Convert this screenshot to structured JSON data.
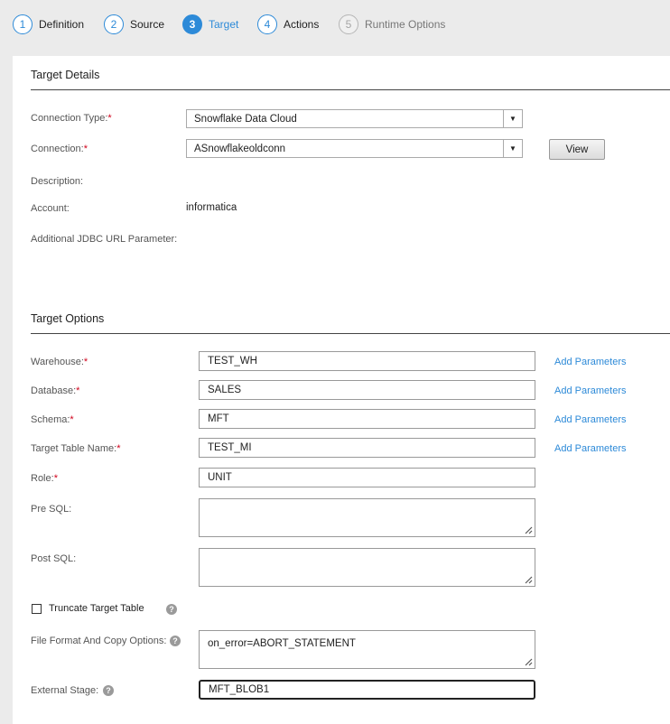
{
  "wizard": {
    "steps": [
      {
        "number": "1",
        "label": "Definition"
      },
      {
        "number": "2",
        "label": "Source"
      },
      {
        "number": "3",
        "label": "Target"
      },
      {
        "number": "4",
        "label": "Actions"
      },
      {
        "number": "5",
        "label": "Runtime Options"
      }
    ],
    "active_step": "Target"
  },
  "target_details": {
    "title": "Target Details",
    "connection_type_label": "Connection Type:",
    "connection_type_value": "Snowflake Data Cloud",
    "connection_label": "Connection:",
    "connection_value": "ASnowflakeoldconn",
    "view_button": "View",
    "description_label": "Description:",
    "account_label": "Account:",
    "account_value": "informatica",
    "jdbc_label": "Additional JDBC URL Parameter:"
  },
  "target_options": {
    "title": "Target Options",
    "warehouse_label": "Warehouse:",
    "warehouse_value": "TEST_WH",
    "database_label": "Database:",
    "database_value": "SALES",
    "schema_label": "Schema:",
    "schema_value": "MFT",
    "table_label": "Target Table Name:",
    "table_value": "TEST_MI",
    "role_label": "Role:",
    "role_value": "UNIT",
    "pre_sql_label": "Pre SQL:",
    "post_sql_label": "Post SQL:",
    "truncate_label": "Truncate Target Table",
    "truncate_checked": false,
    "file_format_label": "File Format And Copy Options:",
    "file_format_value": "on_error=ABORT_STATEMENT",
    "external_stage_label": "External Stage:",
    "external_stage_value": "MFT_BLOB1",
    "add_parameters": "Add Parameters",
    "required_marker": "*",
    "help_glyph": "?"
  },
  "colors": {
    "accent": "#2d8ad8",
    "required": "#d0021b"
  },
  "icons": [
    "dropdown-arrow-icon",
    "help-icon",
    "resize-grip-icon"
  ]
}
